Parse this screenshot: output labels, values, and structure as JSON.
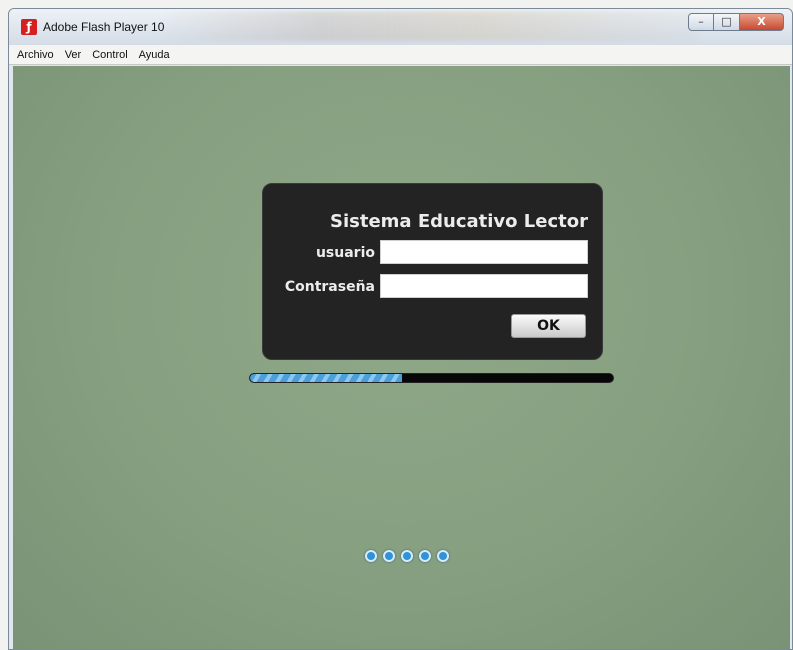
{
  "window": {
    "title": "Adobe Flash Player 10",
    "buttons": {
      "minimize": "–",
      "maximize": "□",
      "close": "X"
    }
  },
  "menubar": {
    "items": [
      {
        "label": "Archivo"
      },
      {
        "label": "Ver"
      },
      {
        "label": "Control"
      },
      {
        "label": "Ayuda"
      }
    ]
  },
  "login": {
    "title": "Sistema Educativo Lector",
    "username_label": "usuario",
    "username_value": "",
    "password_label": "Contraseña",
    "password_value": "",
    "ok_label": "OK"
  },
  "progress": {
    "fraction": 0.42
  },
  "loading_indicator": {
    "dot_count": 5
  },
  "colors": {
    "stage_background": "#869f80",
    "panel_background": "#232323",
    "progress_fill": "#4c9fd8",
    "loader_dots": "#2f93d8"
  },
  "icons": {
    "app": "flash-player-icon"
  }
}
